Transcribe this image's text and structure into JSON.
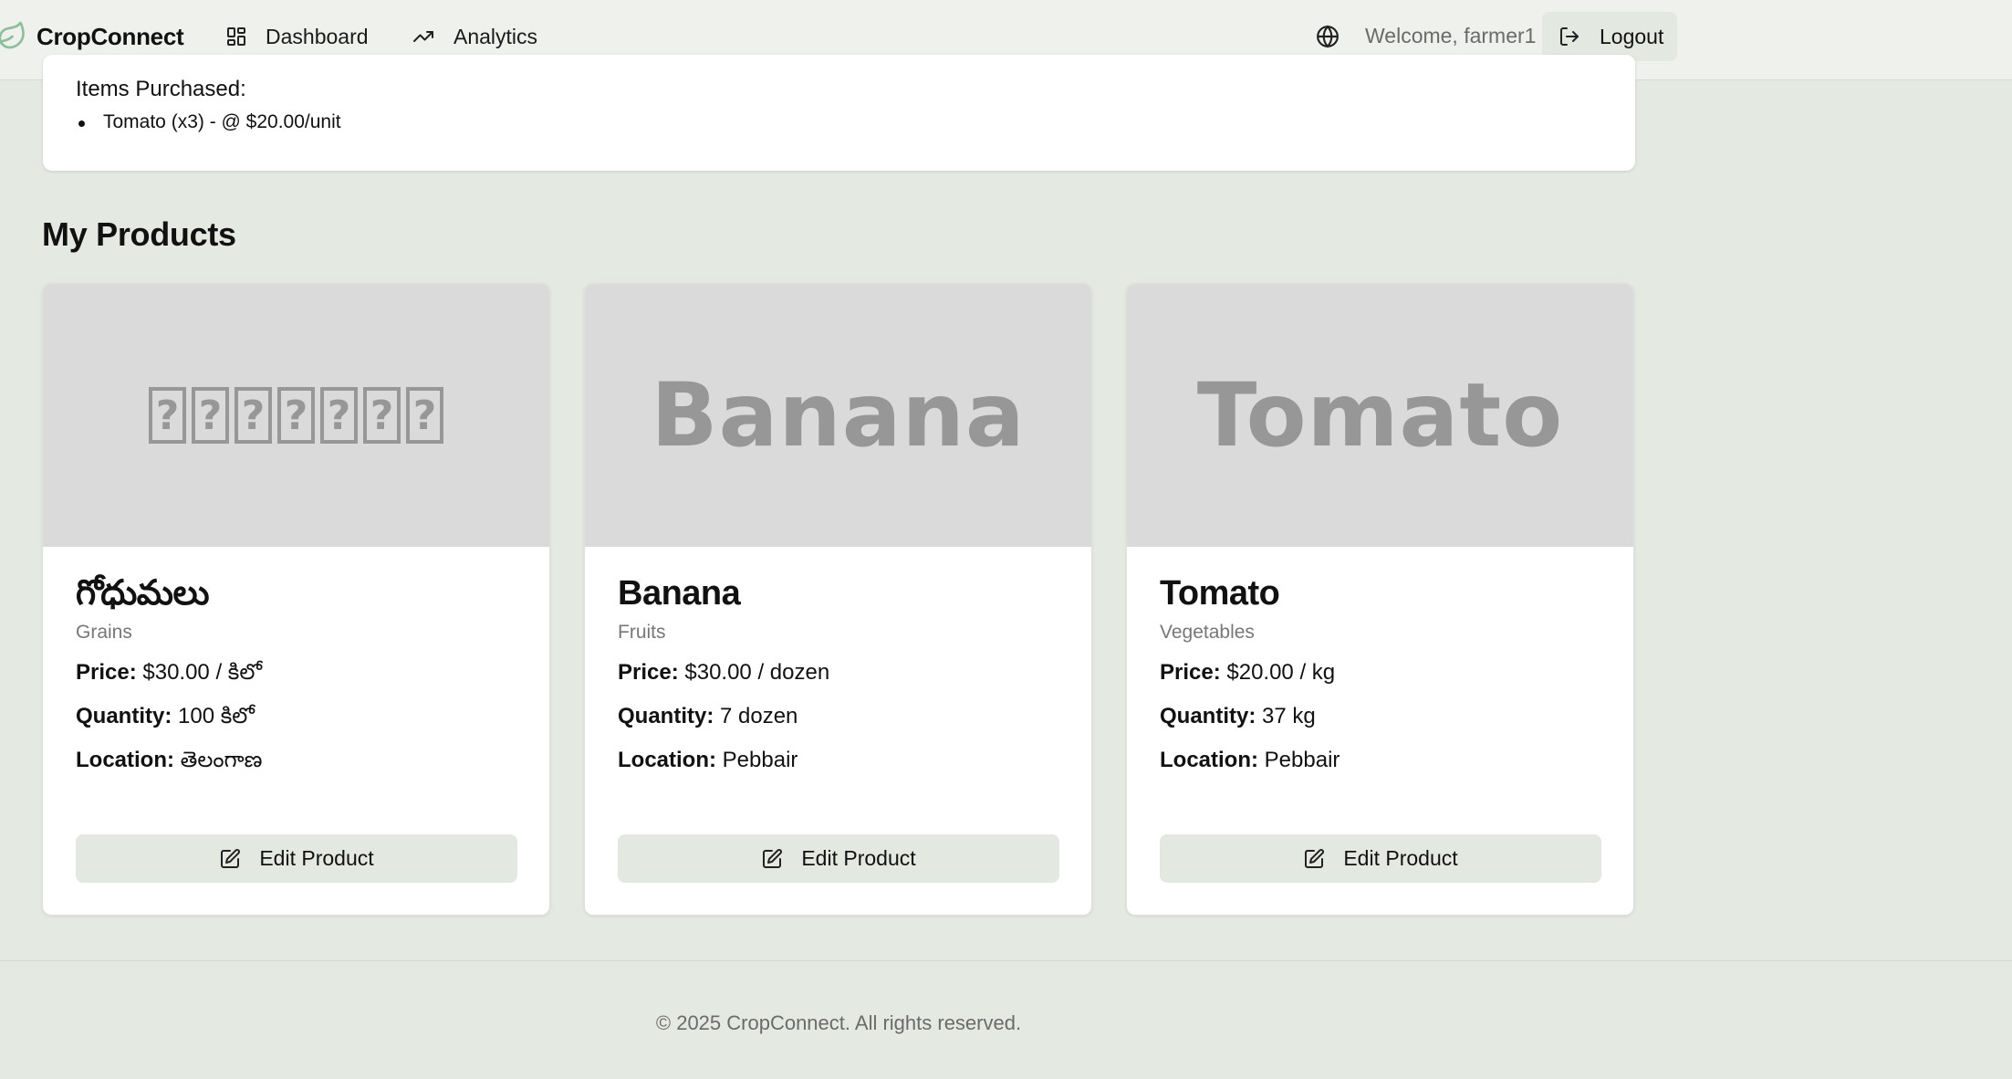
{
  "header": {
    "brand": "CropConnect",
    "nav": [
      {
        "label": "Dashboard",
        "icon": "dashboard-icon"
      },
      {
        "label": "Analytics",
        "icon": "trending-up-icon"
      }
    ],
    "language_icon": "globe-icon",
    "welcome": "Welcome, farmer1",
    "logout_label": "Logout"
  },
  "order": {
    "items_title": "Items Purchased:",
    "items": [
      "Tomato (x3) - @ $20.00/unit"
    ]
  },
  "products_title": "My Products",
  "products": [
    {
      "image_text": "",
      "name": "గోధుమలు",
      "category": "Grains",
      "price_label": "Price:",
      "price": "$30.00 / కిలో",
      "quantity_label": "Quantity:",
      "quantity": "100 కిలో",
      "location_label": "Location:",
      "location": "తెలంగాణ",
      "edit_label": "Edit Product"
    },
    {
      "image_text": "Banana",
      "name": "Banana",
      "category": "Fruits",
      "price_label": "Price:",
      "price": "$30.00 / dozen",
      "quantity_label": "Quantity:",
      "quantity": "7 dozen",
      "location_label": "Location:",
      "location": "Pebbair",
      "edit_label": "Edit Product"
    },
    {
      "image_text": "Tomato",
      "name": "Tomato",
      "category": "Vegetables",
      "price_label": "Price:",
      "price": "$20.00 / kg",
      "quantity_label": "Quantity:",
      "quantity": "37 kg",
      "location_label": "Location:",
      "location": "Pebbair",
      "edit_label": "Edit Product"
    }
  ],
  "footer": "© 2025 CropConnect. All rights reserved.",
  "colors": {
    "background": "#e4e9e2",
    "card": "#ffffff",
    "button": "#e3e8e1",
    "muted_text": "#6b6b6b",
    "leaf_icon": "#8fbf9a"
  }
}
